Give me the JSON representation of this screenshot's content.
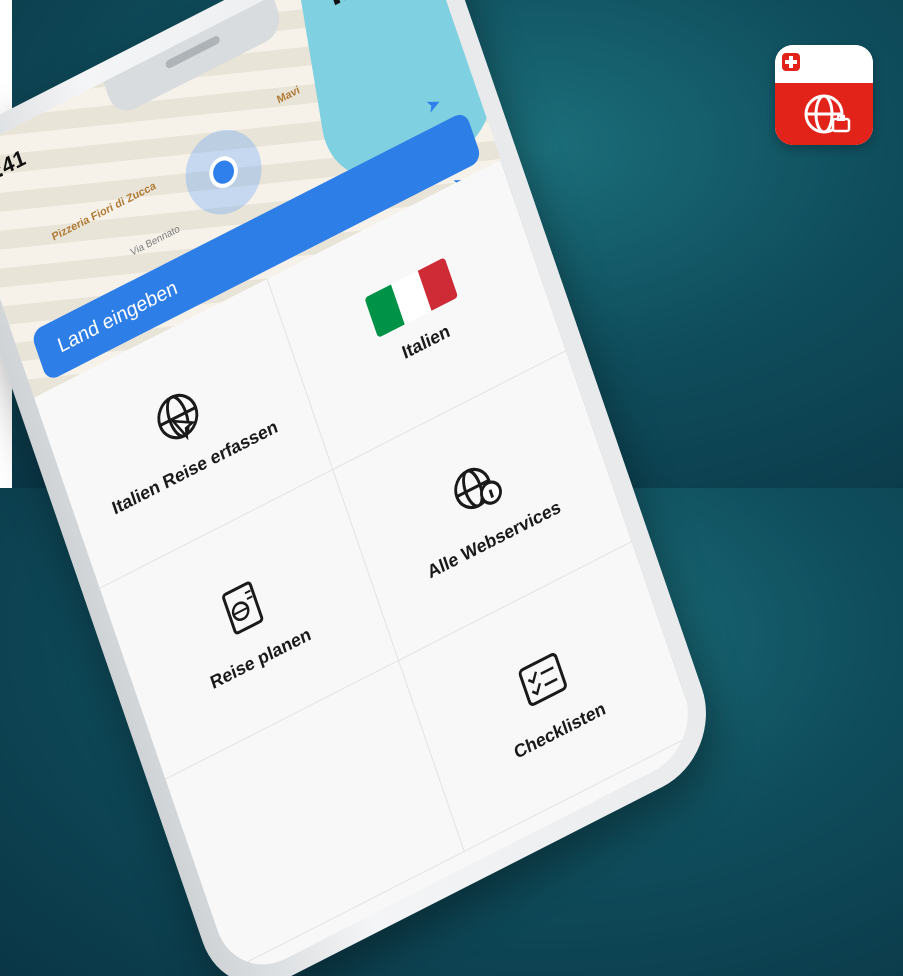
{
  "status": {
    "time": "9:41",
    "icons": "▮▮▮ ◔ ▬"
  },
  "map": {
    "label_pizzeria": "Pizzeria Fiori di Zucca",
    "street": "Via Bennato",
    "label_mavi": "Mavi"
  },
  "search": {
    "placeholder": "Land eingeben"
  },
  "tiles": [
    {
      "label": "Italien",
      "icon": "italy-flag-icon"
    },
    {
      "label": "Italien Reise erfassen",
      "icon": "globe-cursor-icon"
    },
    {
      "label": "Alle Webservices",
      "icon": "globe-info-icon"
    },
    {
      "label": "Reise planen",
      "icon": "passport-icon"
    },
    {
      "label": "Checklisten",
      "icon": "checklist-icon"
    }
  ],
  "colors": {
    "background": "#0f4d5c",
    "accent_blue": "#2e7ee8",
    "swiss_red": "#e2231a",
    "italy_green": "#009246",
    "italy_white": "#ffffff",
    "italy_red": "#ce2b37"
  }
}
